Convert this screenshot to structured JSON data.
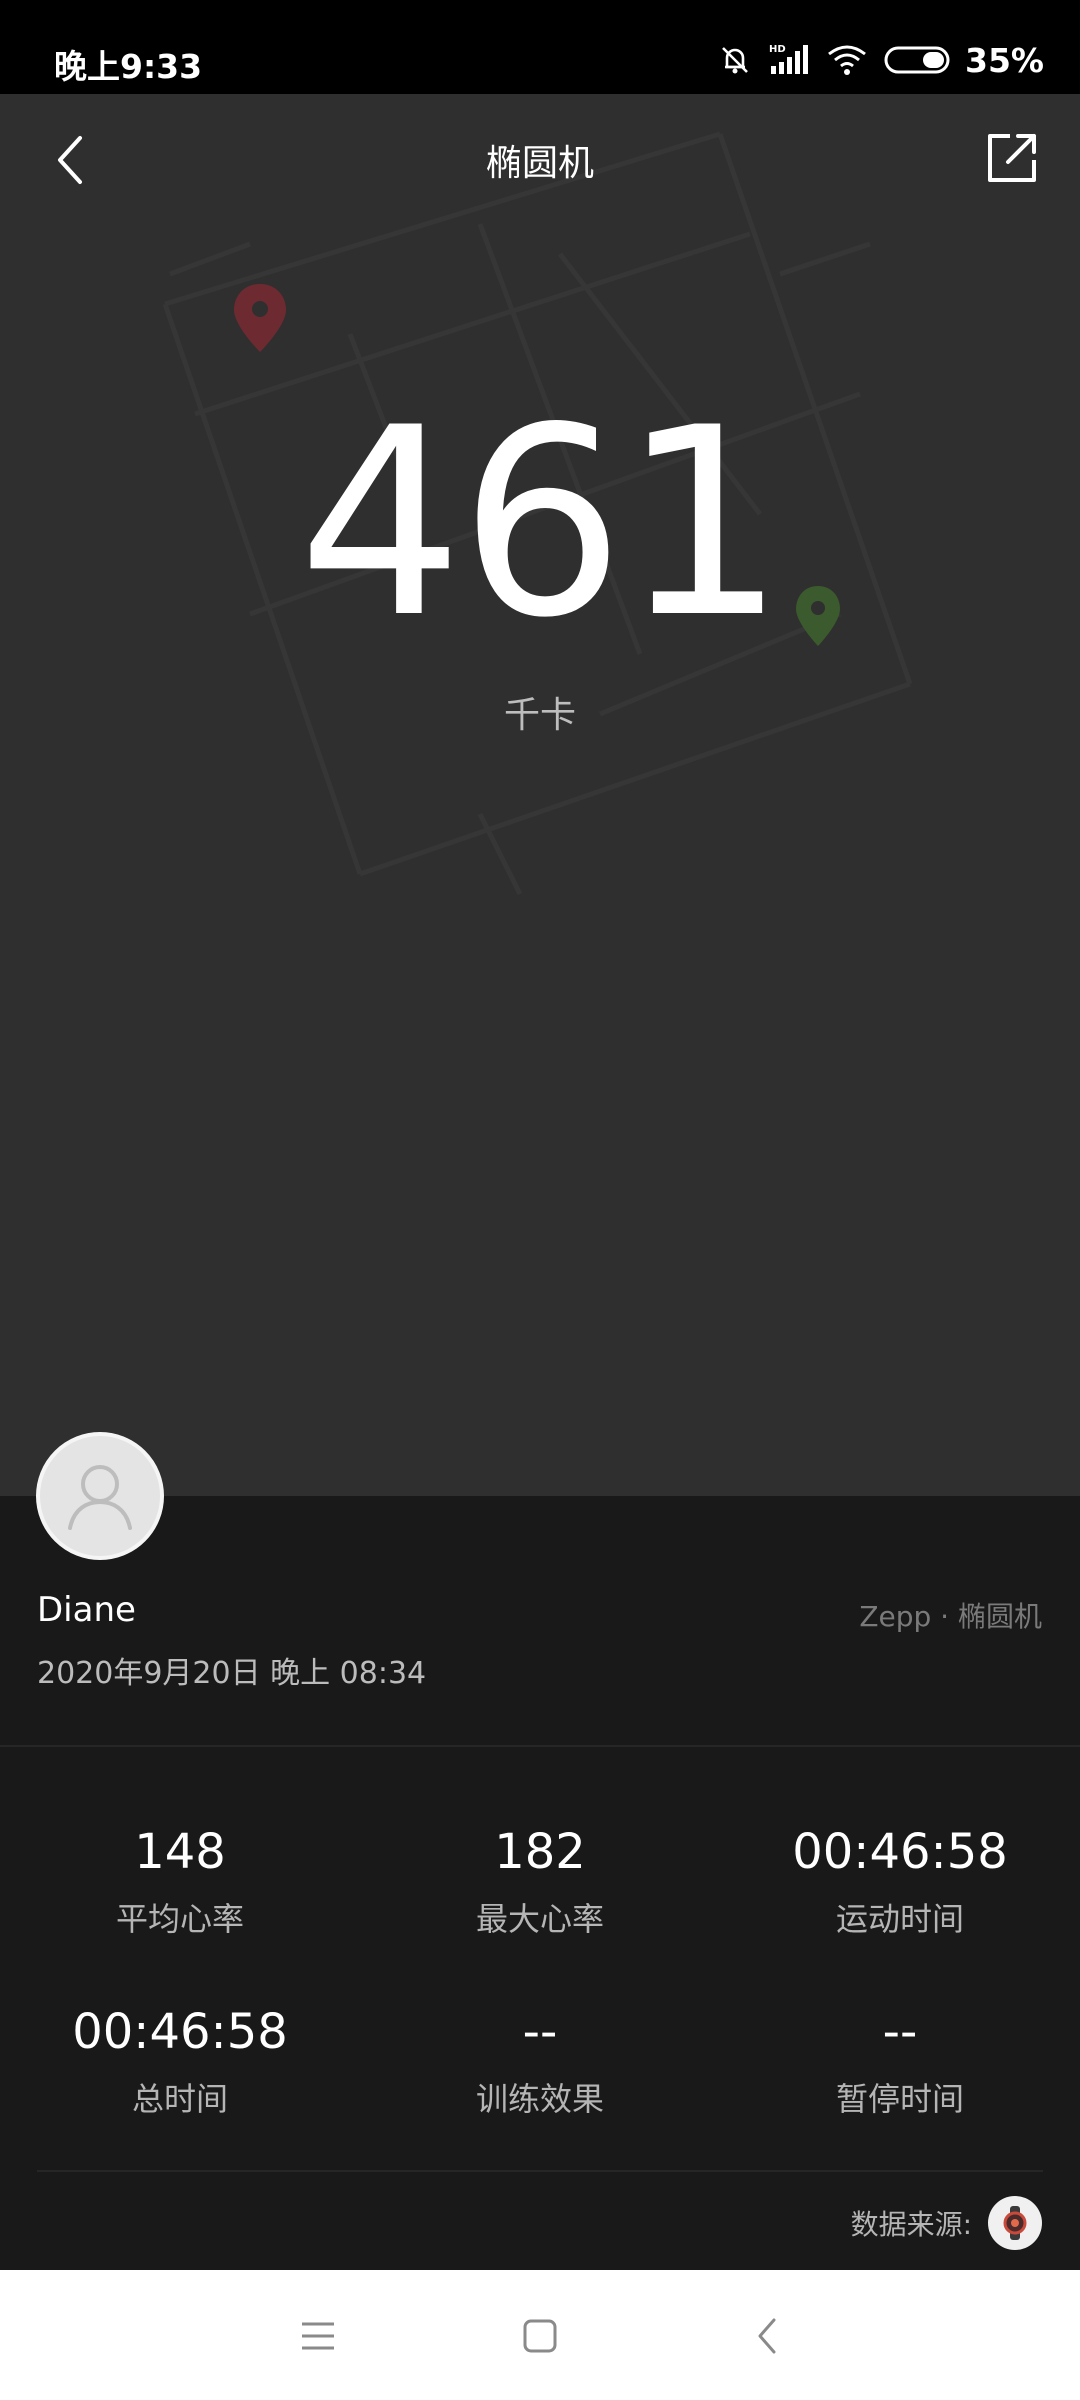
{
  "status_bar": {
    "time": "晚上9:33",
    "battery": "35%",
    "icons": [
      "bell-off-icon",
      "hd-signal-icon",
      "wifi-icon",
      "battery-icon"
    ]
  },
  "header": {
    "title": "椭圆机",
    "back_icon": "chevron-left-icon",
    "share_icon": "share-icon"
  },
  "hero": {
    "calories": "461",
    "unit": "千卡",
    "colors": {
      "background": "#2f2f2f",
      "start_pin": "#7a2a33",
      "end_pin": "#3c6a2f"
    }
  },
  "profile": {
    "name": "Diane",
    "datetime": "2020年9月20日 晚上 08:34",
    "source": "Zepp · 椭圆机"
  },
  "stats": [
    {
      "value": "148",
      "label": "平均心率"
    },
    {
      "value": "182",
      "label": "最大心率"
    },
    {
      "value": "00:46:58",
      "label": "运动时间"
    },
    {
      "value": "00:46:58",
      "label": "总时间"
    },
    {
      "value": "--",
      "label": "训练效果"
    },
    {
      "value": "--",
      "label": "暂停时间"
    }
  ],
  "footer": {
    "data_source_label": "数据来源:",
    "device_icon": "watch-icon"
  },
  "nav": {
    "icons": [
      "menu-icon",
      "home-icon",
      "back-icon"
    ]
  }
}
